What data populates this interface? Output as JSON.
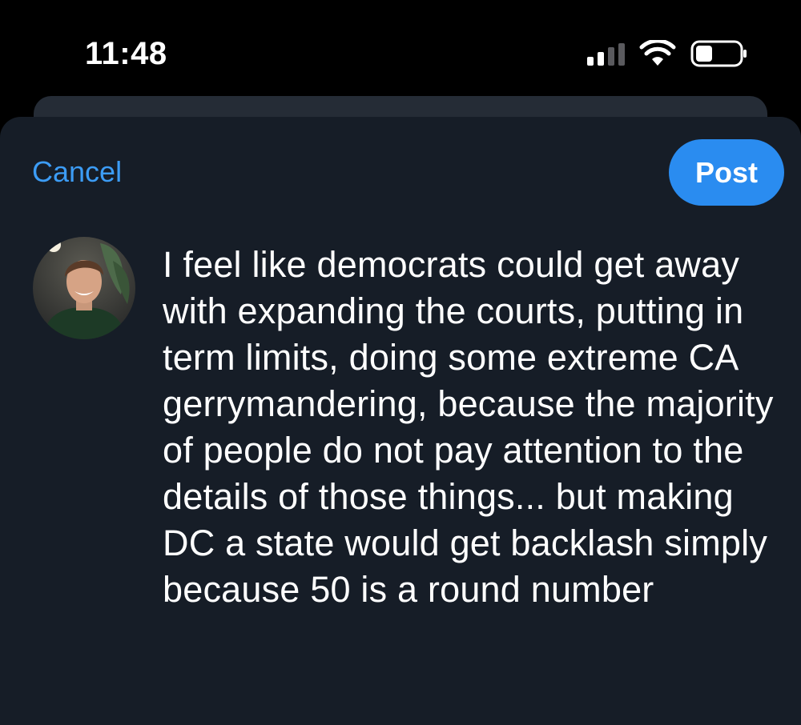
{
  "status_bar": {
    "time": "11:48",
    "signal_icon": "cellular-signal-icon",
    "wifi_icon": "wifi-icon",
    "battery_icon": "battery-icon",
    "battery_level": 0.35
  },
  "composer": {
    "cancel_label": "Cancel",
    "post_label": "Post",
    "avatar_icon": "user-avatar",
    "post_text": "I feel like democrats could get away with expanding the courts, putting in term limits, doing some extreme CA gerrymandering, because the majority of people do not pay attention to the details of those things... but making DC a state would get backlash simply because 50 is a round number"
  },
  "colors": {
    "background": "#000000",
    "sheet": "#161d27",
    "accent": "#2a8cf0",
    "cancel_text": "#3c9cf5",
    "text": "#ffffff"
  }
}
